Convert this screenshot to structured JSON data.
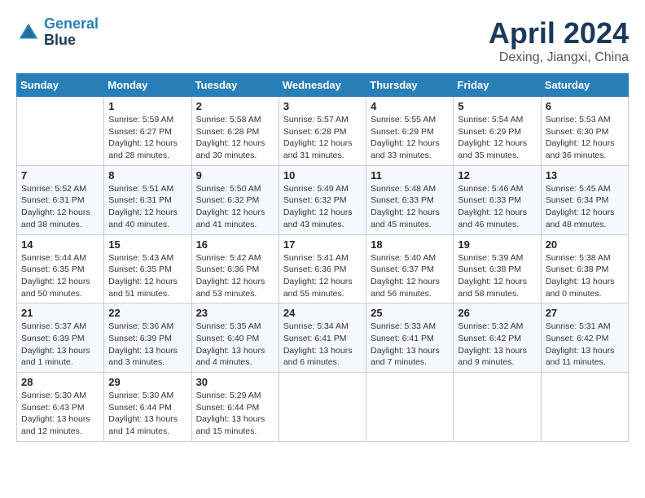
{
  "app": {
    "name": "GeneralBlue",
    "logo_line1": "General",
    "logo_line2": "Blue"
  },
  "calendar": {
    "month": "April 2024",
    "location": "Dexing, Jiangxi, China",
    "days_of_week": [
      "Sunday",
      "Monday",
      "Tuesday",
      "Wednesday",
      "Thursday",
      "Friday",
      "Saturday"
    ],
    "weeks": [
      [
        {
          "day": "",
          "info": ""
        },
        {
          "day": "1",
          "info": "Sunrise: 5:59 AM\nSunset: 6:27 PM\nDaylight: 12 hours\nand 28 minutes."
        },
        {
          "day": "2",
          "info": "Sunrise: 5:58 AM\nSunset: 6:28 PM\nDaylight: 12 hours\nand 30 minutes."
        },
        {
          "day": "3",
          "info": "Sunrise: 5:57 AM\nSunset: 6:28 PM\nDaylight: 12 hours\nand 31 minutes."
        },
        {
          "day": "4",
          "info": "Sunrise: 5:55 AM\nSunset: 6:29 PM\nDaylight: 12 hours\nand 33 minutes."
        },
        {
          "day": "5",
          "info": "Sunrise: 5:54 AM\nSunset: 6:29 PM\nDaylight: 12 hours\nand 35 minutes."
        },
        {
          "day": "6",
          "info": "Sunrise: 5:53 AM\nSunset: 6:30 PM\nDaylight: 12 hours\nand 36 minutes."
        }
      ],
      [
        {
          "day": "7",
          "info": "Sunrise: 5:52 AM\nSunset: 6:31 PM\nDaylight: 12 hours\nand 38 minutes."
        },
        {
          "day": "8",
          "info": "Sunrise: 5:51 AM\nSunset: 6:31 PM\nDaylight: 12 hours\nand 40 minutes."
        },
        {
          "day": "9",
          "info": "Sunrise: 5:50 AM\nSunset: 6:32 PM\nDaylight: 12 hours\nand 41 minutes."
        },
        {
          "day": "10",
          "info": "Sunrise: 5:49 AM\nSunset: 6:32 PM\nDaylight: 12 hours\nand 43 minutes."
        },
        {
          "day": "11",
          "info": "Sunrise: 5:48 AM\nSunset: 6:33 PM\nDaylight: 12 hours\nand 45 minutes."
        },
        {
          "day": "12",
          "info": "Sunrise: 5:46 AM\nSunset: 6:33 PM\nDaylight: 12 hours\nand 46 minutes."
        },
        {
          "day": "13",
          "info": "Sunrise: 5:45 AM\nSunset: 6:34 PM\nDaylight: 12 hours\nand 48 minutes."
        }
      ],
      [
        {
          "day": "14",
          "info": "Sunrise: 5:44 AM\nSunset: 6:35 PM\nDaylight: 12 hours\nand 50 minutes."
        },
        {
          "day": "15",
          "info": "Sunrise: 5:43 AM\nSunset: 6:35 PM\nDaylight: 12 hours\nand 51 minutes."
        },
        {
          "day": "16",
          "info": "Sunrise: 5:42 AM\nSunset: 6:36 PM\nDaylight: 12 hours\nand 53 minutes."
        },
        {
          "day": "17",
          "info": "Sunrise: 5:41 AM\nSunset: 6:36 PM\nDaylight: 12 hours\nand 55 minutes."
        },
        {
          "day": "18",
          "info": "Sunrise: 5:40 AM\nSunset: 6:37 PM\nDaylight: 12 hours\nand 56 minutes."
        },
        {
          "day": "19",
          "info": "Sunrise: 5:39 AM\nSunset: 6:38 PM\nDaylight: 12 hours\nand 58 minutes."
        },
        {
          "day": "20",
          "info": "Sunrise: 5:38 AM\nSunset: 6:38 PM\nDaylight: 13 hours\nand 0 minutes."
        }
      ],
      [
        {
          "day": "21",
          "info": "Sunrise: 5:37 AM\nSunset: 6:39 PM\nDaylight: 13 hours\nand 1 minute."
        },
        {
          "day": "22",
          "info": "Sunrise: 5:36 AM\nSunset: 6:39 PM\nDaylight: 13 hours\nand 3 minutes."
        },
        {
          "day": "23",
          "info": "Sunrise: 5:35 AM\nSunset: 6:40 PM\nDaylight: 13 hours\nand 4 minutes."
        },
        {
          "day": "24",
          "info": "Sunrise: 5:34 AM\nSunset: 6:41 PM\nDaylight: 13 hours\nand 6 minutes."
        },
        {
          "day": "25",
          "info": "Sunrise: 5:33 AM\nSunset: 6:41 PM\nDaylight: 13 hours\nand 7 minutes."
        },
        {
          "day": "26",
          "info": "Sunrise: 5:32 AM\nSunset: 6:42 PM\nDaylight: 13 hours\nand 9 minutes."
        },
        {
          "day": "27",
          "info": "Sunrise: 5:31 AM\nSunset: 6:42 PM\nDaylight: 13 hours\nand 11 minutes."
        }
      ],
      [
        {
          "day": "28",
          "info": "Sunrise: 5:30 AM\nSunset: 6:43 PM\nDaylight: 13 hours\nand 12 minutes."
        },
        {
          "day": "29",
          "info": "Sunrise: 5:30 AM\nSunset: 6:44 PM\nDaylight: 13 hours\nand 14 minutes."
        },
        {
          "day": "30",
          "info": "Sunrise: 5:29 AM\nSunset: 6:44 PM\nDaylight: 13 hours\nand 15 minutes."
        },
        {
          "day": "",
          "info": ""
        },
        {
          "day": "",
          "info": ""
        },
        {
          "day": "",
          "info": ""
        },
        {
          "day": "",
          "info": ""
        }
      ]
    ]
  }
}
